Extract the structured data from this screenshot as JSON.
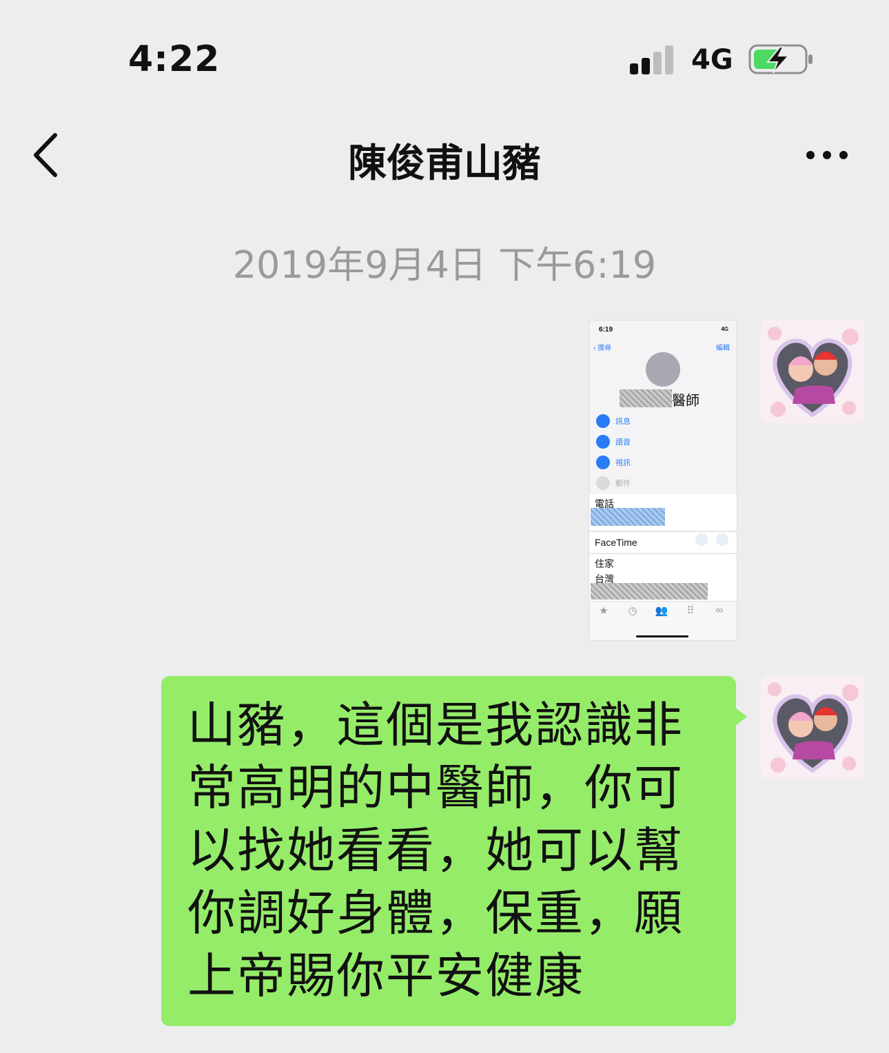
{
  "status_bar": {
    "time": "4:22",
    "network": "4G"
  },
  "header": {
    "title": "陳俊甫山豬",
    "back_icon": "chevron-left-icon",
    "more_icon": "more-dots-icon"
  },
  "chat": {
    "timestamp": "2019年9月4日 下午6:19",
    "image_message": {
      "status_time": "6:19",
      "status_right": "4G",
      "back_label": "搜尋",
      "edit_label": "編輯",
      "name_suffix": "醫師",
      "actions": [
        "訊息",
        "語音",
        "視訊",
        "郵件"
      ],
      "phone_label": "電話",
      "facetime_label": "FaceTime",
      "home_label": "住家",
      "country_label": "台灣"
    },
    "text_message": "山豬，這個是我認識非常高明的中醫師，你可以找她看看，她可以幫你調好身體，保重，願上帝賜你平安健康"
  },
  "colors": {
    "bubble": "#95ec69",
    "background": "#ededed",
    "battery": "#4cd964",
    "link": "#2a7bf6"
  }
}
